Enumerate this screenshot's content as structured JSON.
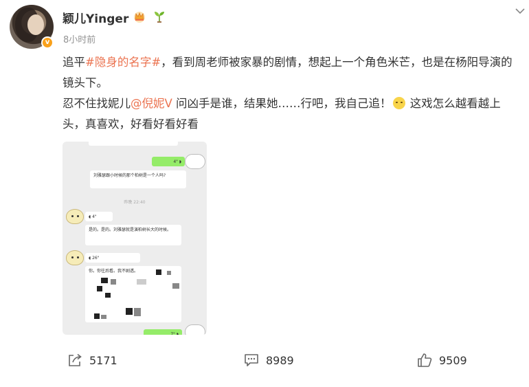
{
  "author": {
    "name": "颖儿Yinger",
    "avatar_icon": "user-photo-avatar",
    "verify_badge": "v",
    "badges": [
      "crown-icon",
      "sprout-icon"
    ]
  },
  "post": {
    "time": "8小时前",
    "text_1": "追平",
    "topic": "#隐身的名字#",
    "text_2": "，看到周老师被家暴的剧情，想起上一个角色米芒，也是在杨阳导演的镜头下。",
    "text_3": "忍不住找妮儿",
    "mention": "@倪妮V",
    "text_4": " 问凶手是谁，结果她……行吧，我自己追！",
    "text_5": " 这戏怎么越看越上头，真喜欢，好看好看好看",
    "emoji": "pensive-emoji"
  },
  "chat_image": {
    "voice_1": "4\"",
    "bubble_1": "刘雅瑟跟小时候的那个柏树是一个人吗?",
    "time_stamp": "昨晚 22:40",
    "voice_2": "4\"",
    "bubble_2": "是的。是的。刘雅瑟就是演柏树长大的时候。",
    "voice_3": "26\"",
    "bubble_3": "你。你往后看。我不剧透。",
    "voice_4": "7\""
  },
  "actions": {
    "share_count": "5171",
    "comment_count": "8989",
    "like_count": "9509"
  },
  "colors": {
    "link": "#eb7350",
    "verify": "#f9a11b",
    "chat_green": "#95ec69"
  }
}
